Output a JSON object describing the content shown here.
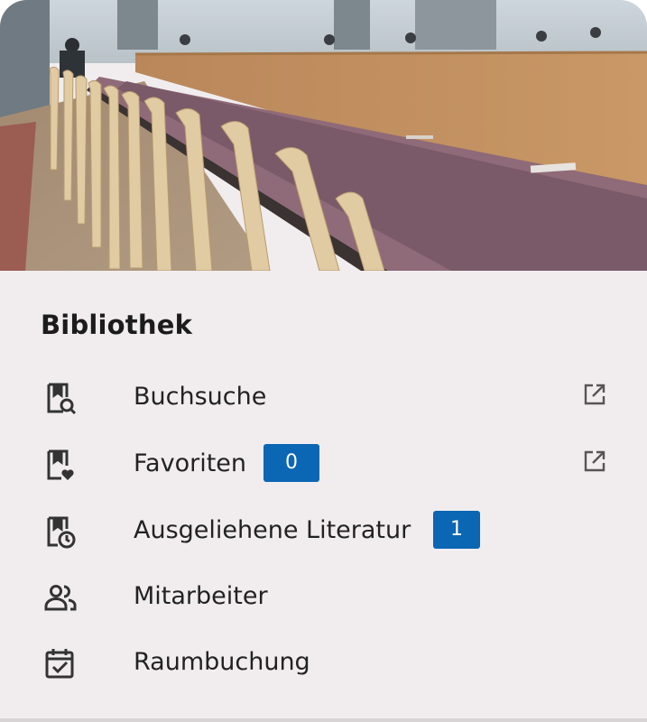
{
  "section": {
    "title": "Bibliothek"
  },
  "items": [
    {
      "label": "Buchsuche",
      "icon": "book-search-icon",
      "external": true
    },
    {
      "label": "Favoriten",
      "icon": "book-heart-icon",
      "badge": "0",
      "external": true
    },
    {
      "label": "Ausgeliehene Literatur",
      "icon": "book-clock-icon",
      "badge": "1",
      "external": false
    },
    {
      "label": "Mitarbeiter",
      "icon": "people-icon",
      "external": false
    },
    {
      "label": "Raumbuchung",
      "icon": "calendar-check-icon",
      "external": false
    }
  ],
  "colors": {
    "badge": "#0b66b3",
    "card_background": "#f1edee"
  }
}
